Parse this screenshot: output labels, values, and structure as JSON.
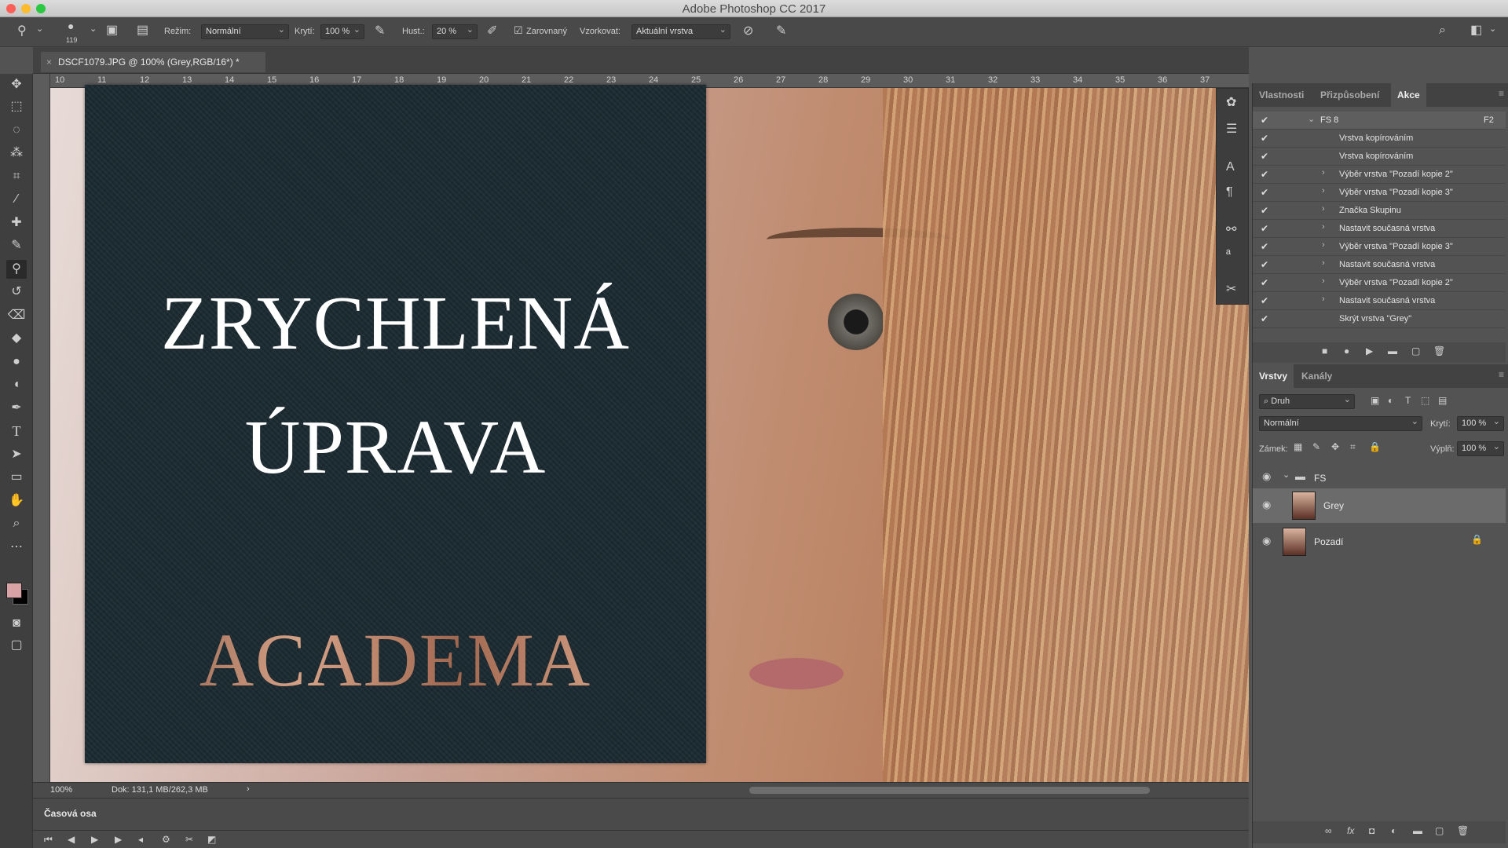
{
  "window": {
    "title": "Adobe Photoshop CC 2017"
  },
  "options_bar": {
    "brush_size": "119",
    "mode_label": "Režim:",
    "mode_value": "Normální",
    "opacity_label": "Krytí:",
    "opacity_value": "100 %",
    "flow_label": "Hust.:",
    "flow_value": "20 %",
    "aligned_label": "Zarovnaný",
    "sample_label": "Vzorkovat:",
    "sample_value": "Aktuální vrstva"
  },
  "document": {
    "tab_title": "DSCF1079.JPG @ 100% (Grey,RGB/16*) *",
    "zoom": "100%",
    "doc_info": "Dok: 131,1 MB/262,3 MB"
  },
  "ruler": {
    "ticks": [
      "10",
      "11",
      "12",
      "13",
      "14",
      "15",
      "16",
      "17",
      "18",
      "19",
      "20",
      "21",
      "22",
      "23",
      "24",
      "25",
      "26",
      "27",
      "28",
      "29",
      "30",
      "31",
      "32",
      "33",
      "34",
      "35",
      "36",
      "37"
    ]
  },
  "actions_panel": {
    "tabs": [
      "Vlastnosti",
      "Přizpůsobení",
      "Akce"
    ],
    "active_tab": "Akce",
    "set_name": "FS 8",
    "set_shortcut": "F2",
    "rows": [
      {
        "label": "Vrstva kopírováním",
        "expandable": false
      },
      {
        "label": "Vrstva kopírováním",
        "expandable": false
      },
      {
        "label": "Výběr vrstva \"Pozadí kopie 2\"",
        "expandable": true
      },
      {
        "label": "Výběr vrstva \"Pozadí kopie 3\"",
        "expandable": true
      },
      {
        "label": "Značka Skupinu",
        "expandable": true
      },
      {
        "label": "Nastavit současná vrstva",
        "expandable": true
      },
      {
        "label": "Výběr vrstva \"Pozadí kopie 3\"",
        "expandable": true
      },
      {
        "label": "Nastavit současná vrstva",
        "expandable": true
      },
      {
        "label": "Výběr vrstva \"Pozadí kopie 2\"",
        "expandable": true
      },
      {
        "label": "Nastavit současná vrstva",
        "expandable": true
      },
      {
        "label": "Skrýt vrstva \"Grey\"",
        "expandable": false
      }
    ]
  },
  "layers_panel": {
    "tabs": [
      "Vrstvy",
      "Kanály"
    ],
    "active_tab": "Vrstvy",
    "filter_value": "Druh",
    "blend_mode": "Normální",
    "opacity_label": "Krytí:",
    "opacity_value": "100 %",
    "lock_label": "Zámek:",
    "fill_label": "Výplň:",
    "fill_value": "100 %",
    "group_name": "FS",
    "layers": [
      {
        "name": "Grey",
        "selected": true
      },
      {
        "name": "Pozadí",
        "selected": false
      }
    ]
  },
  "timeline": {
    "label": "Časová osa"
  },
  "title_card": {
    "headline_line1": "ZRYCHLENÁ",
    "headline_line2": "ÚPRAVA",
    "brand": "ACADEMA",
    "background_color": "#1c2b32",
    "headline_color": "#ffffff",
    "brand_color": "#b77b60"
  },
  "icons": {
    "tools": [
      "move-icon",
      "marquee-icon",
      "lasso-icon",
      "quick-select-icon",
      "crop-icon",
      "eyedropper-icon",
      "healing-icon",
      "brush-icon",
      "clone-stamp-icon",
      "history-brush-icon",
      "eraser-icon",
      "paint-bucket-icon",
      "blur-icon",
      "dodge-icon",
      "pen-icon",
      "type-icon",
      "path-select-icon",
      "rectangle-icon",
      "hand-icon",
      "zoom-icon",
      "more-icon"
    ],
    "foreground_color": "#d9a3a5",
    "background_color": "#000000"
  }
}
